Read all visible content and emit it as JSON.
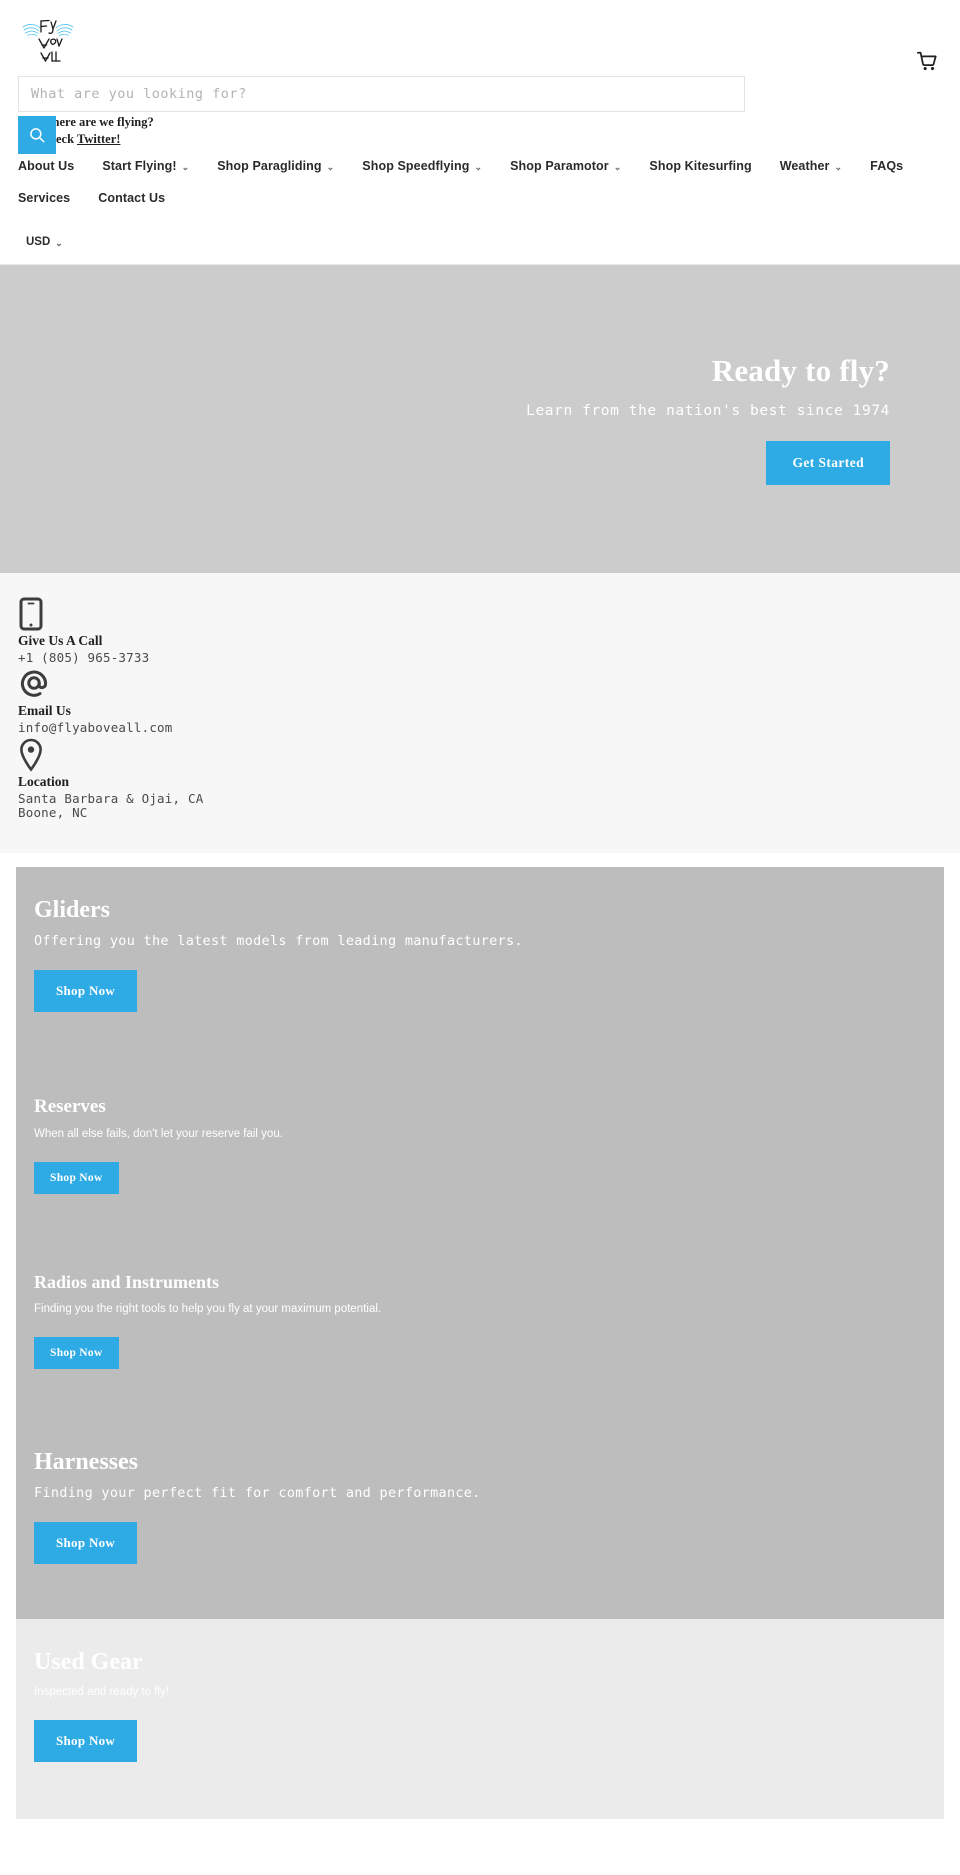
{
  "header": {
    "logo_alt": "Fly Above All",
    "logo_line1": "Fly",
    "logo_line2": "Above",
    "logo_line3": "All",
    "cart_label": "Cart",
    "search": {
      "placeholder": "What are you looking for?",
      "value": "",
      "button_label": "Search"
    },
    "tagline_line1": "Where are we flying?",
    "tagline_line2_prefix": "Check ",
    "tagline_link": "Twitter!",
    "currency": "USD"
  },
  "nav": {
    "items": [
      {
        "label": "About Us",
        "caret": false
      },
      {
        "label": "Start Flying!",
        "caret": true
      },
      {
        "label": "Shop Paragliding",
        "caret": true
      },
      {
        "label": "Shop Speedflying",
        "caret": true
      },
      {
        "label": "Shop Paramotor",
        "caret": true
      },
      {
        "label": "Shop Kitesurfing",
        "caret": false
      },
      {
        "label": "Weather",
        "caret": true
      },
      {
        "label": "FAQs",
        "caret": false
      },
      {
        "label": "Services",
        "caret": false
      },
      {
        "label": "Contact Us",
        "caret": false
      }
    ],
    "caret_glyph": "⌄"
  },
  "hero": {
    "title": "Ready to fly?",
    "subtitle": "Learn from the nation's best since 1974",
    "button_label": "Get Started",
    "background_color": "#cccccc",
    "accent_color": "#2eaae4"
  },
  "contact": {
    "items": [
      {
        "icon": "mobile-phone-icon",
        "title": "Give Us A Call",
        "value": "+1 (805) 965-3733",
        "value2": ""
      },
      {
        "icon": "at-sign-icon",
        "title": "Email Us",
        "value": "info@flyaboveall.com",
        "value2": ""
      },
      {
        "icon": "map-pin-icon",
        "title": "Location",
        "value": "Santa Barbara & Ojai, CA",
        "value2": "Boone, NC"
      }
    ]
  },
  "categories": {
    "items": [
      {
        "title": "Gliders",
        "description": "Offering you the latest models from leading manufacturers.",
        "button_label": "Shop Now"
      },
      {
        "title": "Reserves",
        "description": "When all else fails, don't let your reserve fail you.",
        "button_label": "Shop Now"
      },
      {
        "title": "Radios and Instruments",
        "description": "Finding you the right tools to help you fly at your maximum potential.",
        "button_label": "Shop Now"
      },
      {
        "title": "Harnesses",
        "description": "Finding your perfect fit for comfort and performance.",
        "button_label": "Shop Now"
      },
      {
        "title": "Used Gear",
        "description": "Inspected and ready to fly!",
        "button_label": "Shop Now"
      }
    ]
  }
}
